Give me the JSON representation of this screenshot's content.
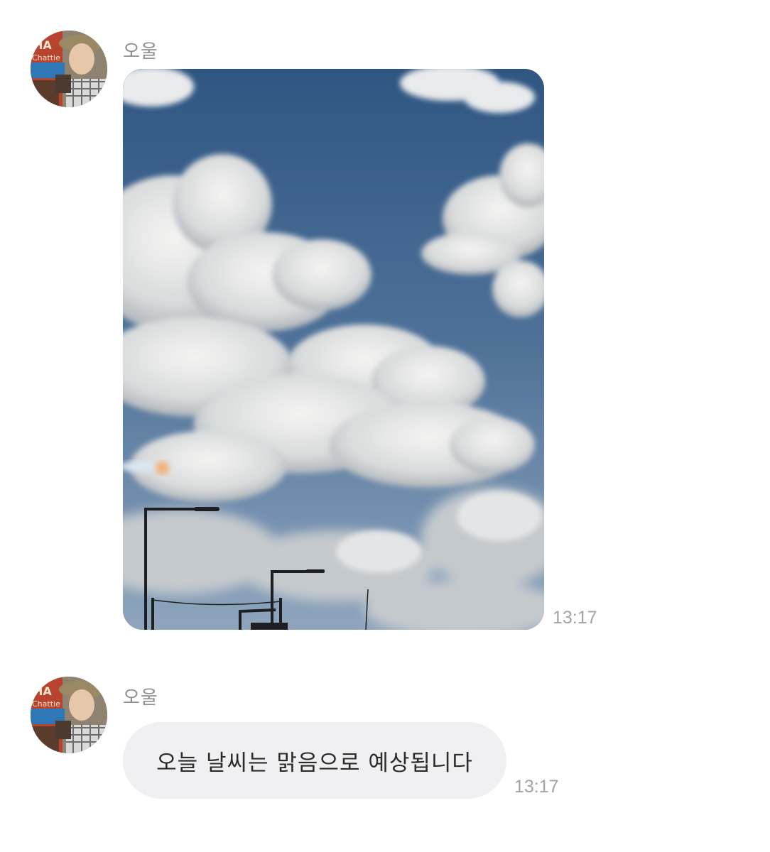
{
  "messages": [
    {
      "sender": "오울",
      "type": "image",
      "image_description_icon": "sky-clouds-photo",
      "time": "13:17"
    },
    {
      "sender": "오울",
      "type": "text",
      "text": "오늘 날씨는 맑음으로 예상됩니다",
      "time": "13:17"
    }
  ],
  "colors": {
    "sender_name": "#8e8e8e",
    "timestamp": "#a3a3a3",
    "bubble_bg": "#f0f0f2",
    "bubble_text": "#2b2b2b",
    "sky": "#3f6187"
  }
}
